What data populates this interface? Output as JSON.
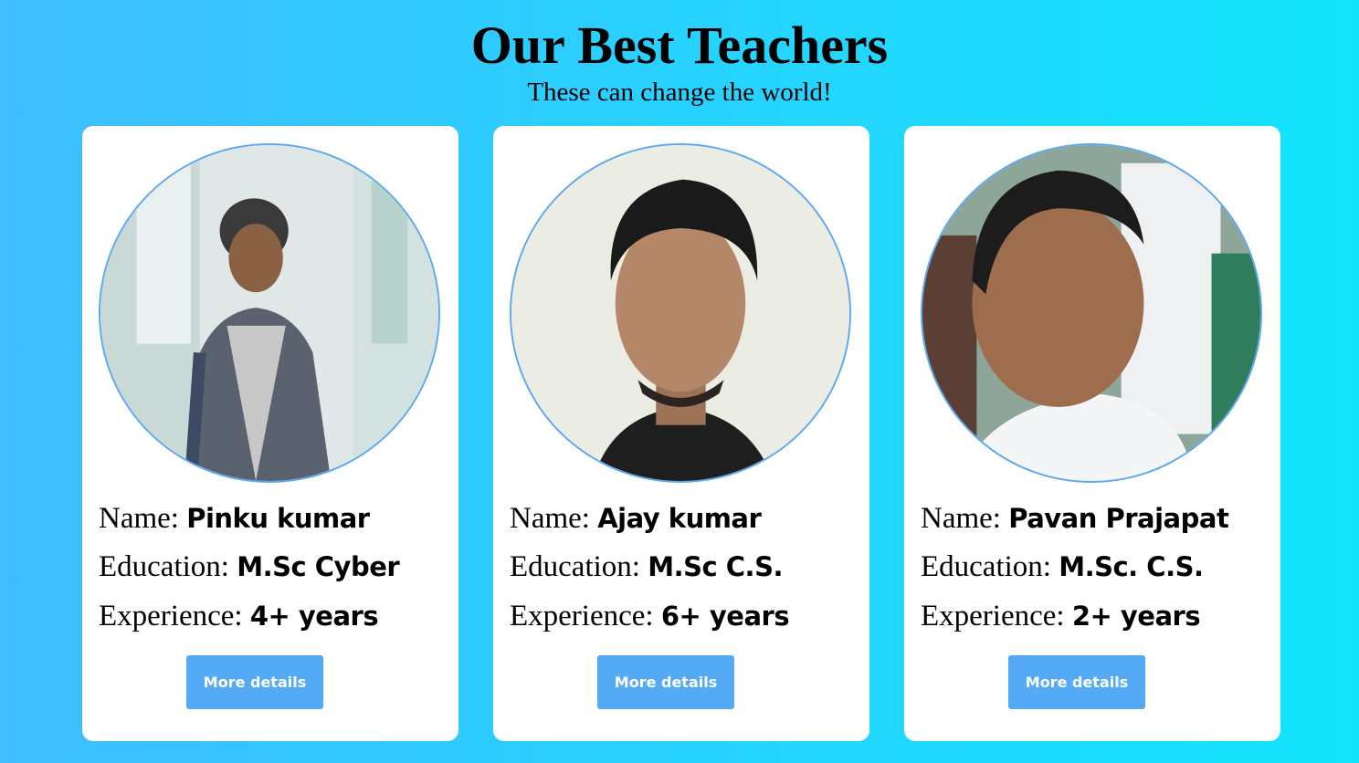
{
  "header": {
    "title": "Our Best Teachers",
    "subtitle": "These can change the world!"
  },
  "labels": {
    "name": "Name:",
    "education": "Education:",
    "experience": "Experience:"
  },
  "teachers": [
    {
      "name": "Pinku kumar",
      "education": "M.Sc Cyber",
      "experience": "4+ years",
      "button": "More details"
    },
    {
      "name": "Ajay kumar",
      "education": "M.Sc C.S.",
      "experience": "6+ years",
      "button": "More details"
    },
    {
      "name": "Pavan Prajapat",
      "education": "M.Sc. C.S.",
      "experience": "2+ years",
      "button": "More details"
    }
  ],
  "colors": {
    "background_left": "#3fbdfd",
    "background_right": "#13e4fd",
    "button": "#55aaf6",
    "avatar_border": "#5aa8ef"
  }
}
